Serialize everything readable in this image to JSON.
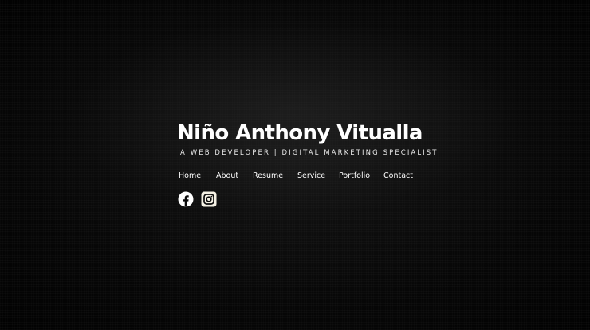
{
  "hero": {
    "name": "Niño Anthony Vitualla",
    "tagline": "A WEB DEVELOPER | DIGITAL MARKETING SPECIALIST"
  },
  "nav": {
    "items": [
      {
        "label": "Home"
      },
      {
        "label": "About"
      },
      {
        "label": "Resume"
      },
      {
        "label": "Service"
      },
      {
        "label": "Portfolio"
      },
      {
        "label": "Contact"
      }
    ]
  },
  "socials": {
    "icons": [
      "facebook-icon",
      "instagram-icon"
    ]
  },
  "colors": {
    "background": "#050505",
    "text": "#ffffff"
  }
}
